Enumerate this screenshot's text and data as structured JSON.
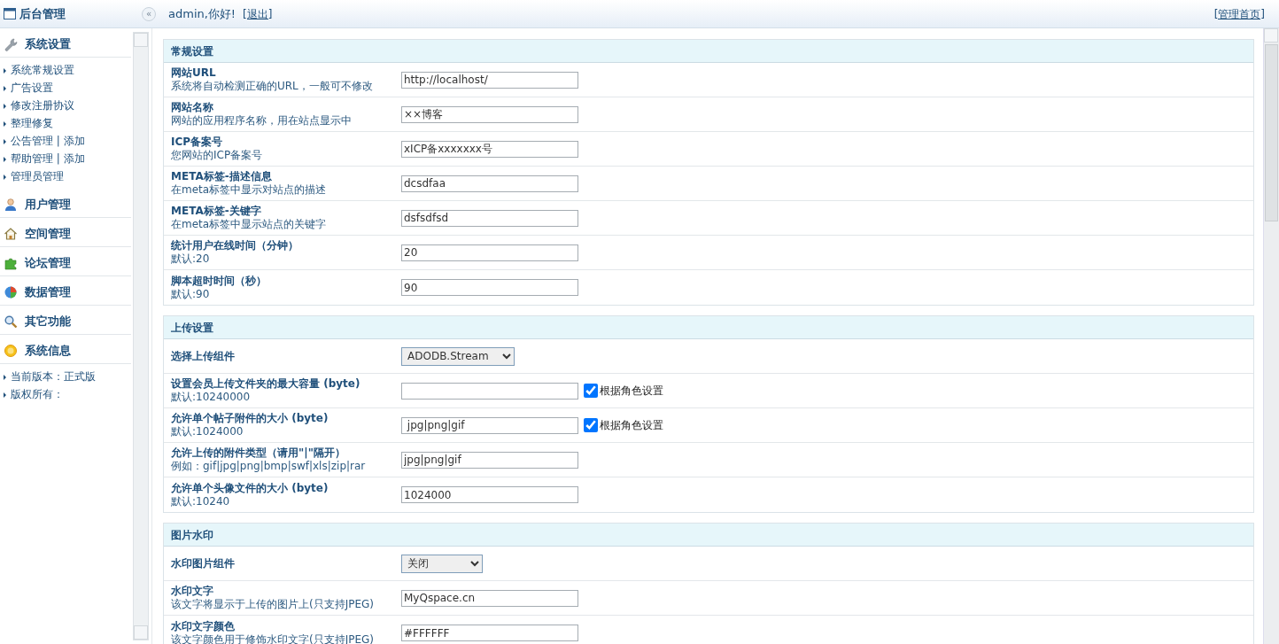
{
  "header": {
    "title": "后台管理",
    "collapse": "«",
    "greeting": "admin,你好!",
    "logout": "[退出]",
    "home_link": "[管理首页]"
  },
  "sidebar": {
    "groups": [
      {
        "title": "系统设置",
        "items": [
          "系统常规设置",
          "广告设置",
          "修改注册协议",
          "整理修复",
          "公告管理 | 添加",
          "帮助管理 | 添加",
          "管理员管理"
        ]
      },
      {
        "title": "用户管理"
      },
      {
        "title": "空间管理"
      },
      {
        "title": "论坛管理"
      },
      {
        "title": "数据管理"
      },
      {
        "title": "其它功能"
      },
      {
        "title": "系统信息",
        "items": [
          "当前版本：正式版",
          "版权所有："
        ]
      }
    ]
  },
  "sections": [
    {
      "title": "常规设置",
      "rows": [
        {
          "kind": "text",
          "label": "网站URL",
          "hint": "系统将自动检测正确的URL，一般可不修改",
          "value": "http://localhost/"
        },
        {
          "kind": "text",
          "label": "网站名称",
          "hint": "网站的应用程序名称，用在站点显示中",
          "value": "××博客"
        },
        {
          "kind": "text",
          "label": "ICP备案号",
          "hint": "您网站的ICP备案号",
          "value": "xICP备xxxxxxx号"
        },
        {
          "kind": "text",
          "label": "META标签-描述信息",
          "hint": "在meta标签中显示对站点的描述",
          "value": "dcsdfaa"
        },
        {
          "kind": "text",
          "label": "META标签-关键字",
          "hint": "在meta标签中显示站点的关键字",
          "value": "dsfsdfsd"
        },
        {
          "kind": "text",
          "label": "统计用户在线时间（分钟）",
          "hint": "默认:20",
          "value": "20"
        },
        {
          "kind": "text",
          "label": "脚本超时时间（秒）",
          "hint": "默认:90",
          "value": "90"
        }
      ]
    },
    {
      "title": "上传设置",
      "rows": [
        {
          "kind": "select",
          "label": "选择上传组件",
          "value": "ADODB.Stream"
        },
        {
          "kind": "check",
          "label": "设置会员上传文件夹的最大容量 (byte)",
          "hint": "默认:10240000",
          "check_label": "根据角色设置",
          "checked": true
        },
        {
          "kind": "check",
          "label": "允许单个帖子附件的大小 (byte)",
          "hint": "默认:1024000",
          "value": " jpg|png|gif",
          "check_label": "根据角色设置",
          "checked": true
        },
        {
          "kind": "text",
          "label": "允许上传的附件类型（请用\"|\"隔开）",
          "hint": "例如：gif|jpg|png|bmp|swf|xls|zip|rar",
          "value": "jpg|png|gif"
        },
        {
          "kind": "text",
          "label": "允许单个头像文件的大小 (byte)",
          "hint": "默认:10240",
          "value": "1024000"
        }
      ]
    },
    {
      "title": "图片水印",
      "rows": [
        {
          "kind": "select",
          "label": "水印图片组件",
          "value": "关闭"
        },
        {
          "kind": "text",
          "label": "水印文字",
          "hint": "该文字将显示于上传的图片上(只支持JPEG)",
          "value": "MyQspace.cn"
        },
        {
          "kind": "text",
          "label": "水印文字颜色",
          "hint": "该文字颜色用于修饰水印文字(只支持JPEG)",
          "value": "#FFFFFF"
        }
      ]
    }
  ]
}
